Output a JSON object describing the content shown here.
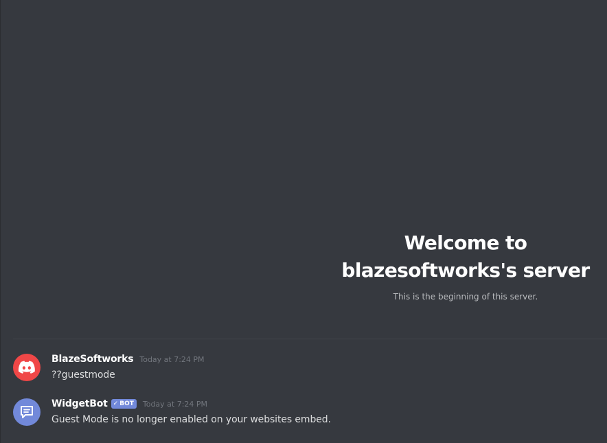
{
  "welcome": {
    "title_line1": "Welcome to",
    "title_line2": "blazesoftworks's server",
    "subtitle": "This is the beginning of this server."
  },
  "messages": [
    {
      "author": "BlazeSoftworks",
      "timestamp": "Today at 7:24 PM",
      "content": "??guestmode",
      "avatar_icon": "discord-logo-icon",
      "avatar_color": "#f04747",
      "is_bot": false
    },
    {
      "author": "WidgetBot",
      "bot_tag": "BOT",
      "timestamp": "Today at 7:24 PM",
      "content": "Guest Mode is no longer enabled on your websites embed.",
      "avatar_icon": "chat-bubble-icon",
      "avatar_color": "#7289da",
      "is_bot": true
    }
  ],
  "colors": {
    "background": "#36393f",
    "bot_tag": "#7289da",
    "text_primary": "#ffffff",
    "text_muted": "#72767d",
    "text_content": "#dcddde"
  }
}
